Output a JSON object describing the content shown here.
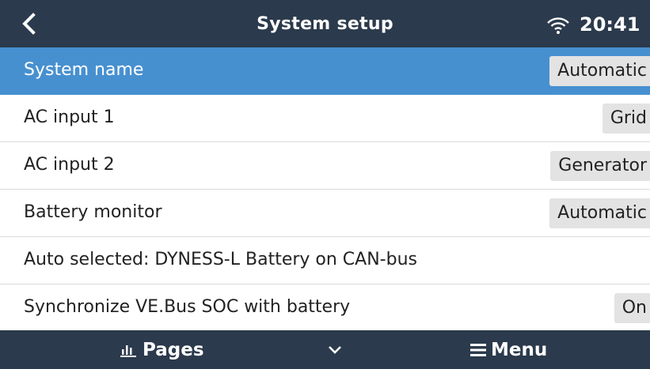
{
  "header": {
    "title": "System setup",
    "time": "20:41"
  },
  "rows": [
    {
      "label": "System name",
      "value": "Automatic"
    },
    {
      "label": "AC input 1",
      "value": "Grid"
    },
    {
      "label": "AC input 2",
      "value": "Generator"
    },
    {
      "label": "Battery monitor",
      "value": "Automatic"
    },
    {
      "label": "Auto selected: DYNESS-L Battery on CAN-bus",
      "value": ""
    },
    {
      "label": "Synchronize VE.Bus SOC with battery",
      "value": "On"
    }
  ],
  "footer": {
    "pages_label": "Pages",
    "menu_label": "Menu"
  },
  "colors": {
    "bar_background": "#2b3a4c",
    "selected_row": "#4790d0",
    "value_chip": "#e3e3e3"
  },
  "icons": [
    "back-icon",
    "wifi-icon",
    "pages-icon",
    "chevron-down-icon",
    "menu-icon"
  ]
}
